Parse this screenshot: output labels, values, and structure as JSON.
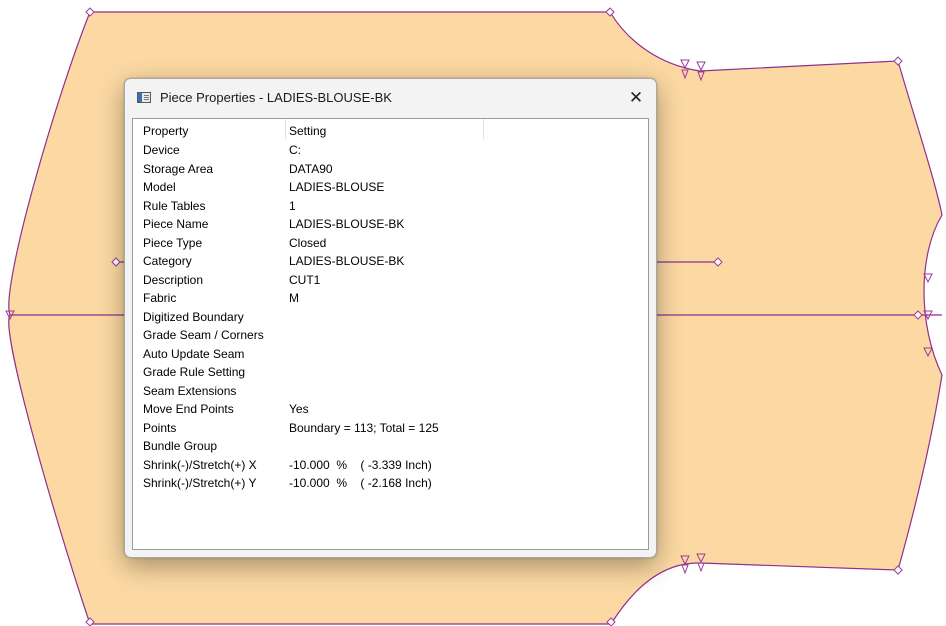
{
  "dialog": {
    "title": "Piece Properties - LADIES-BLOUSE-BK",
    "app_icon": "window-icon",
    "close_glyph": "✕"
  },
  "columns": {
    "property": "Property",
    "setting": "Setting"
  },
  "rows": [
    {
      "property": "Device",
      "setting": "C:"
    },
    {
      "property": "Storage Area",
      "setting": "DATA90"
    },
    {
      "property": "Model",
      "setting": "LADIES-BLOUSE"
    },
    {
      "property": "Rule Tables",
      "setting": "1"
    },
    {
      "property": "Piece Name",
      "setting": "LADIES-BLOUSE-BK"
    },
    {
      "property": "Piece Type",
      "setting": "Closed"
    },
    {
      "property": "Category",
      "setting": "LADIES-BLOUSE-BK"
    },
    {
      "property": "Description",
      "setting": "CUT1"
    },
    {
      "property": "Fabric",
      "setting": "M"
    },
    {
      "property": "Digitized Boundary",
      "setting": ""
    },
    {
      "property": "Grade Seam / Corners",
      "setting": ""
    },
    {
      "property": "Auto Update Seam",
      "setting": ""
    },
    {
      "property": "Grade Rule Setting",
      "setting": ""
    },
    {
      "property": "Seam Extensions",
      "setting": ""
    },
    {
      "property": "Move End Points",
      "setting": "Yes"
    },
    {
      "property": "Points",
      "setting": "Boundary = 113;  Total = 125"
    },
    {
      "property": "Bundle Group",
      "setting": ""
    },
    {
      "property": "Shrink(-)/Stretch(+) X",
      "setting": "-10.000  %    ( -3.339 Inch)"
    },
    {
      "property": "Shrink(-)/Stretch(+) Y",
      "setting": "-10.000  %    ( -2.168 Inch)"
    }
  ],
  "colors": {
    "piece_fill": "#fcd9a3",
    "piece_outline": "#8f2f8f",
    "marker": "#9a3a9a"
  }
}
